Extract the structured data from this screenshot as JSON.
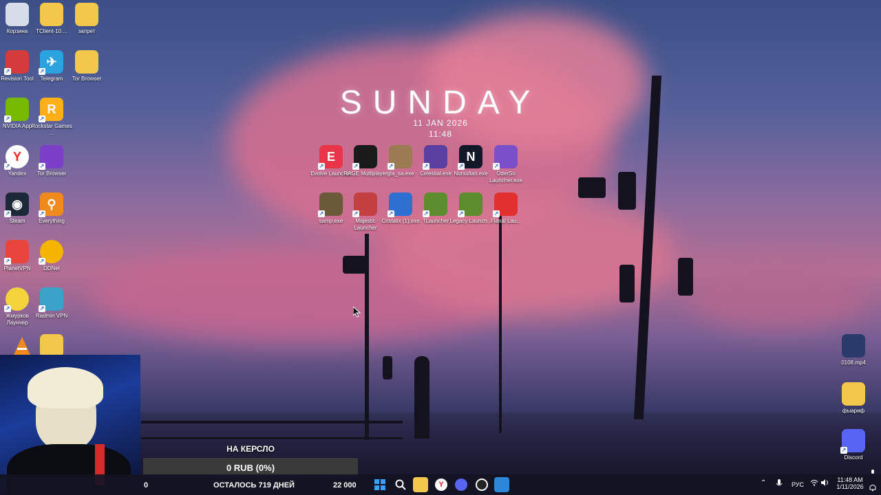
{
  "clock_widget": {
    "day": "SUNDAY",
    "date": "11 JAN 2026",
    "time": "11:48"
  },
  "desktop_left": [
    {
      "label": "Корзина",
      "icon": "recycle-bin-icon"
    },
    {
      "label": "TClient-10....",
      "icon": "folder-icon"
    },
    {
      "label": "запрет",
      "icon": "folder-icon"
    },
    {
      "label": "Revision Tool",
      "icon": "revision-tool-icon"
    },
    {
      "label": "Telegram",
      "icon": "telegram-icon"
    },
    {
      "label": "Tor Browser",
      "icon": "folder-icon"
    },
    {
      "label": "NVIDIA App",
      "icon": "nvidia-icon"
    },
    {
      "label": "Rockstar Games ...",
      "icon": "rockstar-icon"
    },
    {
      "label": "Yandex",
      "icon": "yandex-icon"
    },
    {
      "label": "Tor Browser",
      "icon": "tor-icon"
    },
    {
      "label": "Steam",
      "icon": "steam-icon"
    },
    {
      "label": "Everything",
      "icon": "everything-icon"
    },
    {
      "label": "PlanetVPN",
      "icon": "planetvpn-icon"
    },
    {
      "label": "DDNet",
      "icon": "ddnet-icon"
    },
    {
      "label": "Жмурков Лаунчер",
      "icon": "launcher-icon"
    },
    {
      "label": "Radmin VPN",
      "icon": "radmin-icon"
    }
  ],
  "desktop_center": [
    {
      "label": "Evolve Launcher",
      "icon": "evolve-icon"
    },
    {
      "label": "RAGE Multiplayer",
      "icon": "rage-icon"
    },
    {
      "label": "gta_sa.exe",
      "icon": "gta-icon"
    },
    {
      "label": "Celestial.exe",
      "icon": "celestial-icon"
    },
    {
      "label": "Nursultan.exe",
      "icon": "nursultan-icon"
    },
    {
      "label": "OderSo Launcher.exe",
      "icon": "oderso-icon"
    },
    {
      "label": "samp.exe",
      "icon": "samp-icon"
    },
    {
      "label": "Majestic Launcher",
      "icon": "majestic-icon"
    },
    {
      "label": "Cristalix (1).exe",
      "icon": "cristalix-icon"
    },
    {
      "label": "TLauncher",
      "icon": "tlauncher-icon"
    },
    {
      "label": "Legacy Launch...",
      "icon": "legacy-icon"
    },
    {
      "label": "Flanal Lau...",
      "icon": "flanal-icon"
    }
  ],
  "desktop_right": [
    {
      "label": "0108.mp4",
      "icon": "video-file-icon"
    },
    {
      "label": "фыариф",
      "icon": "folder-icon"
    },
    {
      "label": "Discord",
      "icon": "discord-icon"
    }
  ],
  "donation": {
    "title": "НА КЕРСЛО",
    "progress_text": "0 RUB (0%)",
    "progress_fraction": 0,
    "start": "0",
    "remaining": "ОСТАЛОСЬ 719 ДНЕЙ",
    "goal": "22 000"
  },
  "taskbar": {
    "tray_lang": "РУС",
    "time": "11:48 AM",
    "date": "1/11/2026"
  }
}
